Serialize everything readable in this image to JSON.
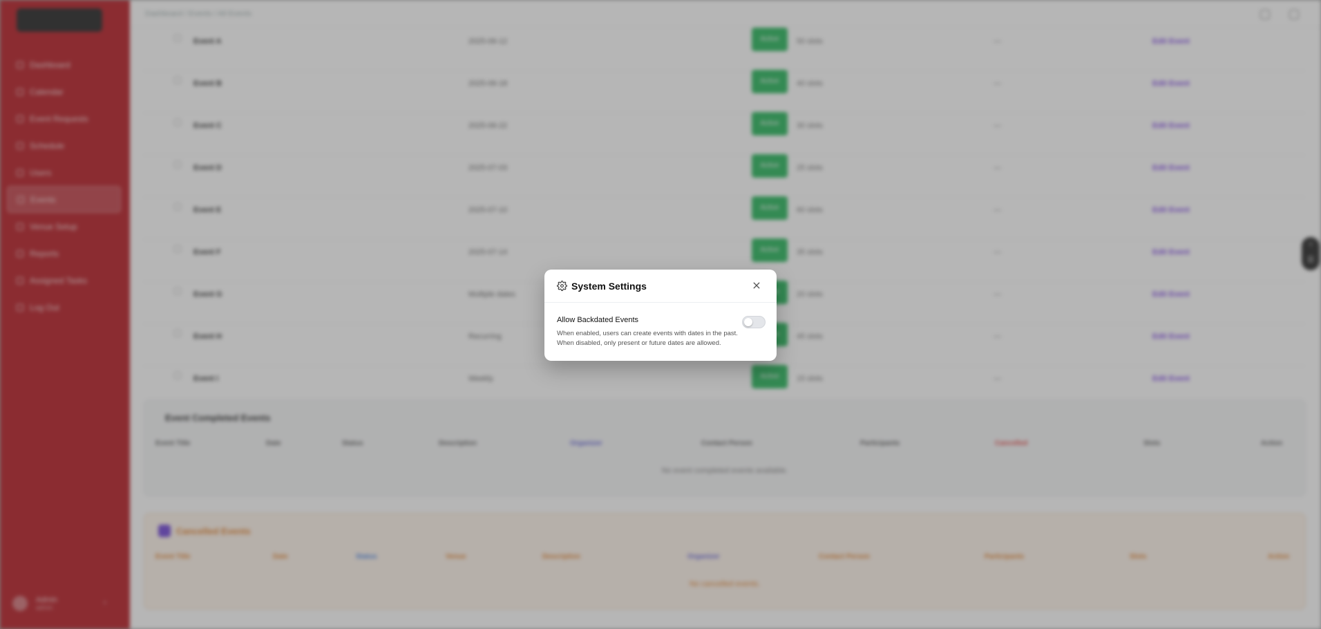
{
  "sidebar": {
    "items": [
      {
        "label": "Dashboard"
      },
      {
        "label": "Calendar"
      },
      {
        "label": "Event Requests"
      },
      {
        "label": "Schedule"
      },
      {
        "label": "Users"
      },
      {
        "label": "Events"
      },
      {
        "label": "Venue Setup"
      },
      {
        "label": "Reports"
      },
      {
        "label": "Assigned Tasks"
      },
      {
        "label": "Log Out"
      }
    ],
    "user": {
      "name": "Admin",
      "role": "admin"
    }
  },
  "topbar": {
    "breadcrumb": "Dashboard / Events / All Events"
  },
  "rows": [
    {
      "name": "Event A",
      "date": "2025-06-12",
      "status": "Active",
      "slots": "50 slots",
      "extra": "—",
      "action": "Edit Event"
    },
    {
      "name": "Event B",
      "date": "2025-06-18",
      "status": "Active",
      "slots": "40 slots",
      "extra": "—",
      "action": "Edit Event"
    },
    {
      "name": "Event C",
      "date": "2025-06-22",
      "status": "Active",
      "slots": "30 slots",
      "extra": "—",
      "action": "Edit Event"
    },
    {
      "name": "Event D",
      "date": "2025-07-03",
      "status": "Active",
      "slots": "25 slots",
      "extra": "—",
      "action": "Edit Event"
    },
    {
      "name": "Event E",
      "date": "2025-07-10",
      "status": "Active",
      "slots": "60 slots",
      "extra": "—",
      "action": "Edit Event"
    },
    {
      "name": "Event F",
      "date": "2025-07-14",
      "status": "Active",
      "slots": "35 slots",
      "extra": "—",
      "action": "Edit Event"
    },
    {
      "name": "Event G",
      "date": "Multiple dates",
      "status": "Active",
      "slots": "20 slots",
      "extra": "—",
      "action": "Edit Event"
    },
    {
      "name": "Event H",
      "date": "Recurring",
      "status": "Active",
      "slots": "45 slots",
      "extra": "—",
      "action": "Edit Event"
    },
    {
      "name": "Event I",
      "date": "Weekly",
      "status": "Active",
      "slots": "15 slots",
      "extra": "—",
      "action": "Edit Event"
    }
  ],
  "panel_completed": {
    "title": "Event Completed Events",
    "headers": [
      "Event Title",
      "Date",
      "Status",
      "Description",
      "Organizer",
      "Contact Person",
      "Participants",
      "Cancelled",
      "Slots",
      "Action"
    ],
    "empty": "No event completed events available."
  },
  "panel_cancelled": {
    "title": "Cancelled Events",
    "headers": [
      "Event Title",
      "Date",
      "Status",
      "Venue",
      "Description",
      "Organizer",
      "Contact Person",
      "Participants",
      "Slots",
      "Action"
    ],
    "empty": "No cancelled events."
  },
  "modal": {
    "title": "System Settings",
    "option_label": "Allow Backdated Events",
    "option_desc_1": "When enabled, users can create events with dates in the past.",
    "option_desc_2": "When disabled, only present or future dates are allowed.",
    "toggle_on": false
  },
  "colors": {
    "sidebar": "#b5121b",
    "status_green": "#1fb455",
    "link_purple": "#7b3fe4",
    "cancel_red": "#e23b3b",
    "orange": "#e07b22"
  }
}
